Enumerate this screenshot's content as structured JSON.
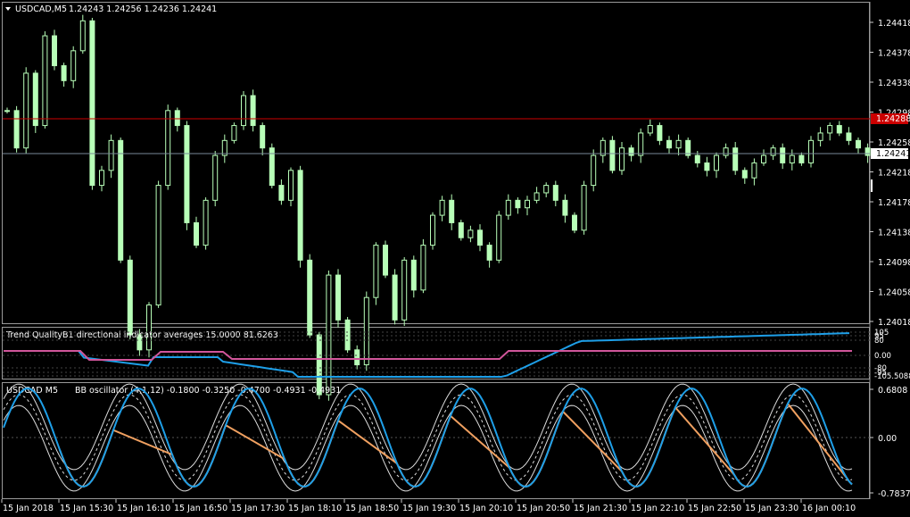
{
  "main_panel": {
    "symbol": "USDCAD,M5",
    "ohlc": "1.24243 1.24256 1.24236 1.24241",
    "price_ticks": [
      "1.24418",
      "1.24378",
      "1.24338",
      "1.24298",
      "1.24258",
      "1.24218",
      "1.24178",
      "1.24138",
      "1.24098",
      "1.24058",
      "1.24018"
    ],
    "ask_line": "1.24288",
    "bid_line": "1.24241"
  },
  "trend_panel": {
    "title": "Trend Quality",
    "subtitle": "B1 directional indicator averages 15.0000 81.6263",
    "ticks": [
      "105",
      "95",
      "80",
      "0.00",
      "-80",
      "-95",
      "-105.5088"
    ]
  },
  "bb_panel": {
    "title": "USDCAD M5",
    "subtitle": "BB oscillator (4,1,12) -0.1800 -0.3250 -0.4700 -0.4931 -0.4931",
    "ticks": [
      "0.6808",
      "0.00",
      "-0.7837"
    ]
  },
  "time_axis": [
    "15 Jan 2018",
    "15 Jan 15:30",
    "15 Jan 16:10",
    "15 Jan 16:50",
    "15 Jan 17:30",
    "15 Jan 18:10",
    "15 Jan 18:50",
    "15 Jan 19:30",
    "15 Jan 20:10",
    "15 Jan 20:50",
    "15 Jan 21:30",
    "15 Jan 22:10",
    "15 Jan 22:50",
    "15 Jan 23:30",
    "16 Jan 00:10"
  ],
  "colors": {
    "candle": "#b8ffb8",
    "ask_line": "#cc0000",
    "bid_line": "#778899",
    "trend_line": "#1e9fe8",
    "neutral_line": "#d0569a",
    "bb_blue": "#1e9fe8",
    "bb_orange": "#f0a060",
    "grid": "#ffffff"
  },
  "chart_data": {
    "type": "line",
    "closes": [
      1.243,
      1.2425,
      1.2435,
      1.2428,
      1.244,
      1.2436,
      1.2434,
      1.2438,
      1.2442,
      1.242,
      1.2422,
      1.2426,
      1.241,
      1.24,
      1.2398,
      1.2404,
      1.242,
      1.243,
      1.2428,
      1.2415,
      1.2412,
      1.2418,
      1.2424,
      1.2426,
      1.2428,
      1.2432,
      1.2428,
      1.2425,
      1.242,
      1.2418,
      1.2422,
      1.241,
      1.24,
      1.2392,
      1.2408,
      1.2402,
      1.2398,
      1.2396,
      1.2405,
      1.2412,
      1.2408,
      1.2402,
      1.241,
      1.2406,
      1.2412,
      1.2416,
      1.2418,
      1.2415,
      1.2413,
      1.2414,
      1.2412,
      1.241,
      1.2416,
      1.2418,
      1.2417,
      1.2418,
      1.2419,
      1.242,
      1.2418,
      1.2416,
      1.2414,
      1.242,
      1.2424,
      1.2426,
      1.2422,
      1.2425,
      1.2424,
      1.2427,
      1.2428,
      1.2426,
      1.2425,
      1.2426,
      1.2424,
      1.2423,
      1.2422,
      1.2424,
      1.2425,
      1.2422,
      1.2421,
      1.2423,
      1.2424,
      1.2425,
      1.2423,
      1.2424,
      1.2423,
      1.2426,
      1.2427,
      1.2428,
      1.2427,
      1.2426,
      1.2425,
      1.2424
    ]
  }
}
